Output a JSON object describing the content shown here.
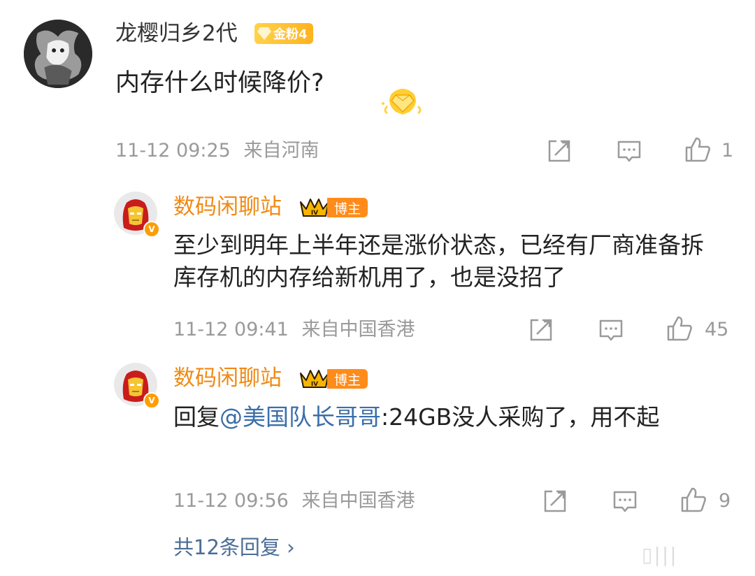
{
  "main_comment": {
    "username": "龙樱归乡2代",
    "fan_badge": "金粉4",
    "text": "内存什么时候降价?",
    "time": "11-12 09:25",
    "location": "来自河南",
    "likes": "1"
  },
  "replies": [
    {
      "username": "数码闲聊站",
      "badge_level": "IV",
      "badge_label": "博主",
      "verified": "V",
      "prefix": "",
      "mention": "",
      "text": "至少到明年上半年还是涨价状态，已经有厂商准备拆库存机的内存给新机用了，也是没招了",
      "time": "11-12 09:41",
      "location": "来自中国香港",
      "likes": "45"
    },
    {
      "username": "数码闲聊站",
      "badge_level": "IV",
      "badge_label": "博主",
      "verified": "V",
      "prefix": "回复",
      "mention": "@美国队长哥哥",
      "text": ":24GB没人采购了，用不起",
      "time": "11-12 09:56",
      "location": "来自中国香港",
      "likes": "9"
    }
  ],
  "footer": {
    "more_replies": "共12条回复 ›",
    "watermark": "▯|||"
  },
  "colors": {
    "username_orange": "#f08a14",
    "mention_blue": "#3a6ea8",
    "meta_gray": "#9a9a9a",
    "badge_gold": "#ffb21f",
    "blogger_orange": "#ff8c1a"
  }
}
